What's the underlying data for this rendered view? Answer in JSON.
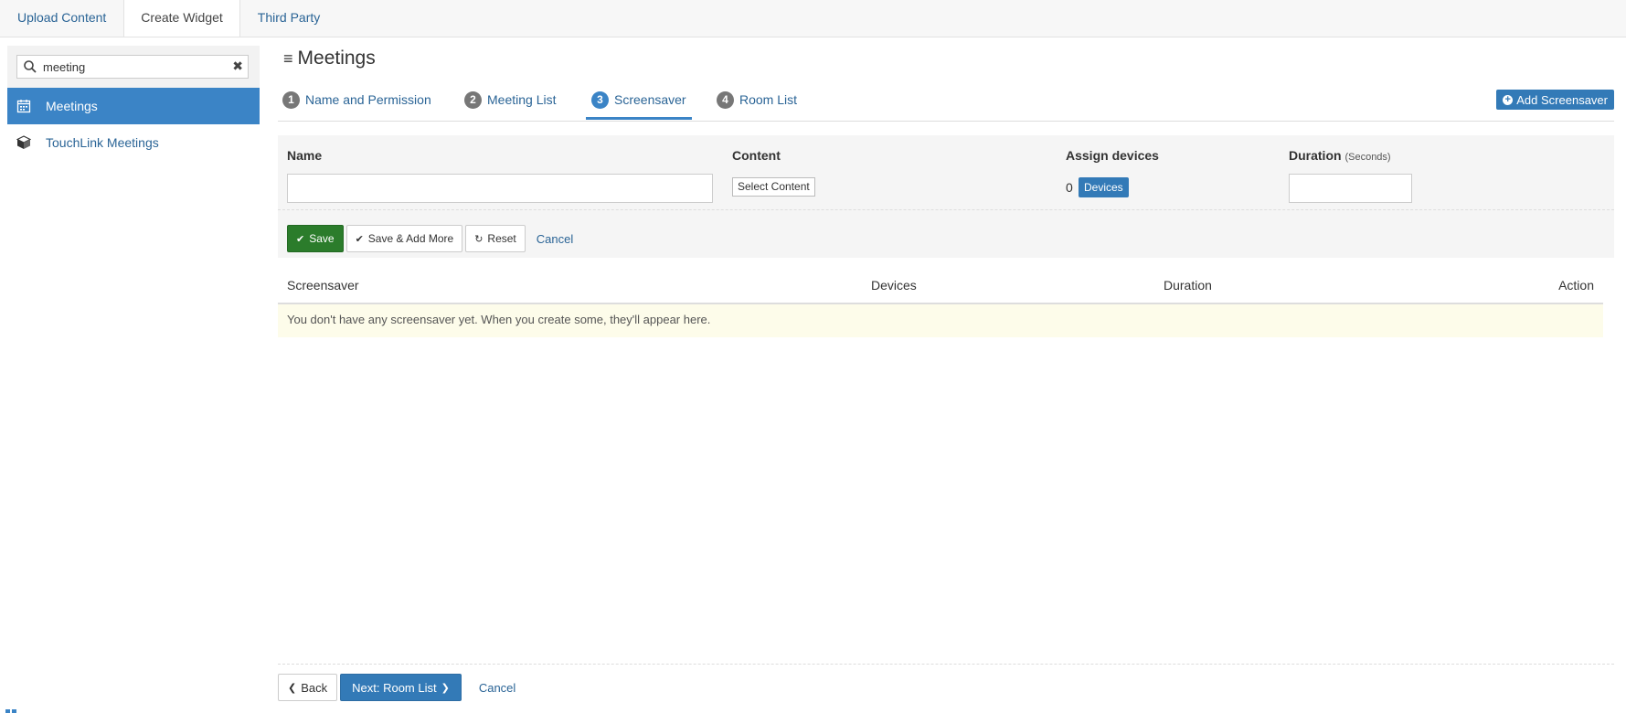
{
  "top_tabs": [
    {
      "label": "Upload Content",
      "active": false
    },
    {
      "label": "Create Widget",
      "active": true
    },
    {
      "label": "Third Party",
      "active": false
    }
  ],
  "sidebar": {
    "search_value": "meeting",
    "items": [
      {
        "label": "Meetings",
        "icon": "calendar-icon",
        "active": true
      },
      {
        "label": "TouchLink Meetings",
        "icon": "cube-icon",
        "active": false
      }
    ]
  },
  "main": {
    "title": "Meetings",
    "steps": [
      {
        "num": "1",
        "label": "Name and Permission"
      },
      {
        "num": "2",
        "label": "Meeting List"
      },
      {
        "num": "3",
        "label": "Screensaver",
        "active": true
      },
      {
        "num": "4",
        "label": "Room List"
      }
    ],
    "add_button_label": "Add Screensaver",
    "form": {
      "name_label": "Name",
      "name_value": "",
      "content_label": "Content",
      "select_content_label": "Select Content",
      "assign_label": "Assign devices",
      "device_count": "0",
      "devices_label": "Devices",
      "duration_label": "Duration",
      "duration_unit": "(Seconds)",
      "duration_value": ""
    },
    "actions": {
      "save": "Save",
      "save_add_more": "Save & Add More",
      "reset": "Reset",
      "cancel": "Cancel"
    },
    "table": {
      "columns": [
        "Screensaver",
        "Devices",
        "Duration",
        "Action"
      ],
      "empty_message": "You don't have any screensaver yet. When you create some, they'll appear here."
    },
    "footer": {
      "back": "Back",
      "next": "Next: Room List",
      "cancel": "Cancel"
    }
  },
  "colors": {
    "accent": "#337ab7",
    "sidebar_active": "#3b84c6",
    "save_green": "#2b7c2b",
    "link": "#2a6496",
    "empty_row_bg": "#fdfcea"
  }
}
